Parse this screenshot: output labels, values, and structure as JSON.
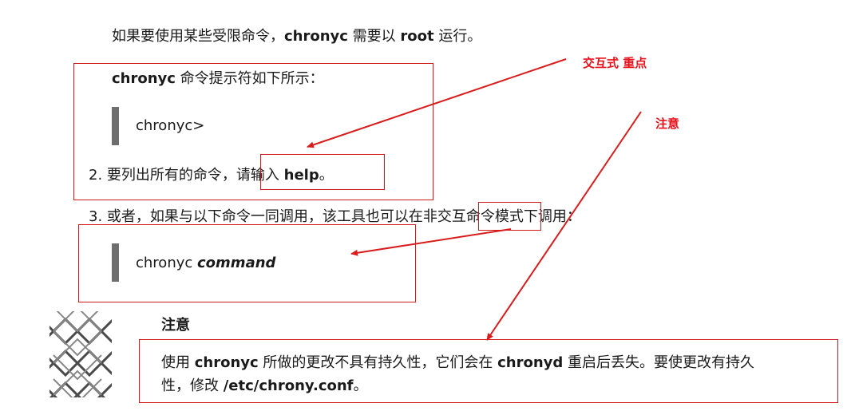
{
  "intro": {
    "text_before": "如果要使用某些受限命令，",
    "cmd": "chronyc",
    "text_middle": " 需要以 ",
    "user": "root",
    "text_after": " 运行。"
  },
  "prompt_desc": {
    "cmd": "chronyc",
    "text": " 命令提示符如下所示："
  },
  "code1": {
    "text": "chronyc>"
  },
  "step2": {
    "number": "2.",
    "text_before": "要列出所有的命令，",
    "text_boxed": "请输入 ",
    "help": "help",
    "text_end": "。"
  },
  "step3": {
    "number": "3.",
    "text": "或者，如果与以下命令一同调用，该工具也可以在非交互命令模式下调用："
  },
  "code2": {
    "cmd": "chronyc ",
    "arg": "command"
  },
  "note": {
    "title": "注意",
    "text_1": "使用 ",
    "cmd": "chronyc",
    "text_2": " 所做的更改不具有持久性，它们会在 ",
    "daemon": "chronyd",
    "text_3": " 重启后丢失。要使更改有持久",
    "line2_text": "性，修改 ",
    "file": "/etc/chrony.conf",
    "line2_end": "。"
  },
  "annotations": {
    "interactive": "交互式  重点",
    "attention": "注意",
    "color": "#e8101a"
  },
  "icons": {
    "note": "note-pattern-icon"
  },
  "colors": {
    "text": "#1a1a1a",
    "code_bar": "#6e6e6e",
    "annotation_box": "#d01a1a"
  }
}
